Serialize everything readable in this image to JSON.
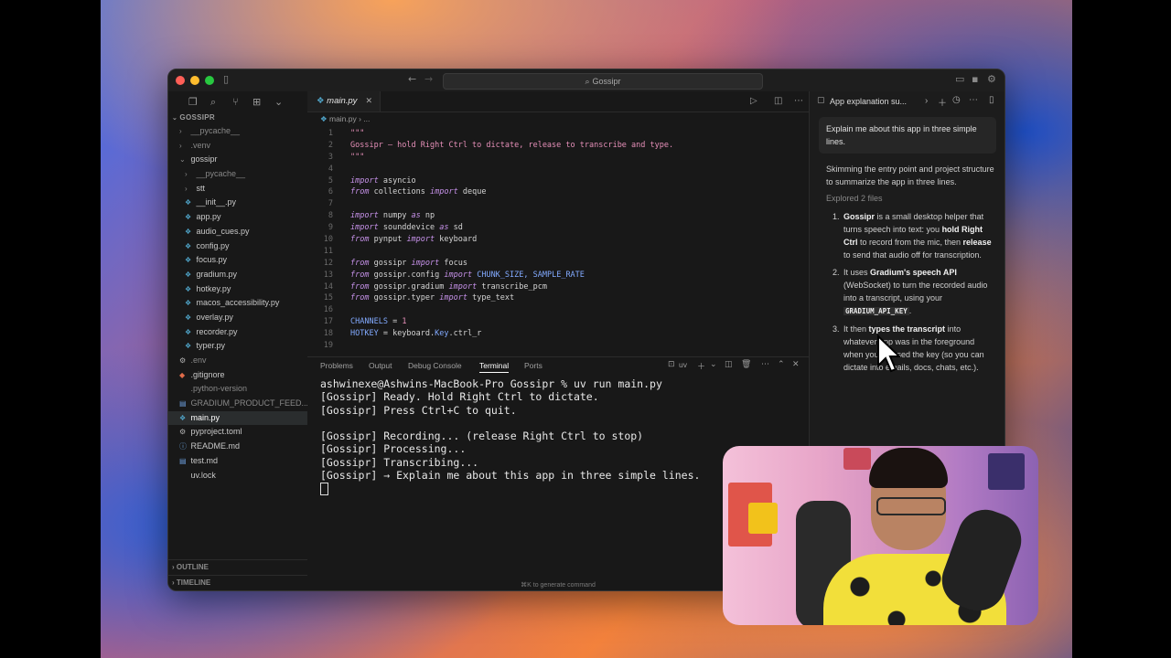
{
  "window": {
    "search_label": "Gossipr"
  },
  "sidebar": {
    "header": "GOSSIPR",
    "items": [
      {
        "label": "__pycache__",
        "type": "folder",
        "depth": 1,
        "dim": true
      },
      {
        "label": ".venv",
        "type": "folder",
        "depth": 1,
        "dim": true
      },
      {
        "label": "gossipr",
        "type": "folder-open",
        "depth": 1,
        "dim": false
      },
      {
        "label": "__pycache__",
        "type": "folder",
        "depth": 2,
        "dim": true
      },
      {
        "label": "stt",
        "type": "folder",
        "depth": 2,
        "dim": false
      },
      {
        "label": "__init__.py",
        "type": "py",
        "depth": 2,
        "dim": false
      },
      {
        "label": "app.py",
        "type": "py",
        "depth": 2,
        "dim": false
      },
      {
        "label": "audio_cues.py",
        "type": "py",
        "depth": 2,
        "dim": false
      },
      {
        "label": "config.py",
        "type": "py",
        "depth": 2,
        "dim": false
      },
      {
        "label": "focus.py",
        "type": "py",
        "depth": 2,
        "dim": false
      },
      {
        "label": "gradium.py",
        "type": "py",
        "depth": 2,
        "dim": false
      },
      {
        "label": "hotkey.py",
        "type": "py",
        "depth": 2,
        "dim": false
      },
      {
        "label": "macos_accessibility.py",
        "type": "py",
        "depth": 2,
        "dim": false
      },
      {
        "label": "overlay.py",
        "type": "py",
        "depth": 2,
        "dim": false
      },
      {
        "label": "recorder.py",
        "type": "py",
        "depth": 2,
        "dim": false
      },
      {
        "label": "typer.py",
        "type": "py",
        "depth": 2,
        "dim": false
      },
      {
        "label": ".env",
        "type": "gear",
        "depth": 1,
        "dim": true
      },
      {
        "label": ".gitignore",
        "type": "git",
        "depth": 1,
        "dim": false
      },
      {
        "label": ".python-version",
        "type": "plain",
        "depth": 1,
        "dim": true
      },
      {
        "label": "GRADIUM_PRODUCT_FEED...",
        "type": "md",
        "depth": 1,
        "dim": true
      },
      {
        "label": "main.py",
        "type": "py",
        "depth": 1,
        "dim": false,
        "selected": true
      },
      {
        "label": "pyproject.toml",
        "type": "gear",
        "depth": 1,
        "dim": false
      },
      {
        "label": "README.md",
        "type": "info",
        "depth": 1,
        "dim": false
      },
      {
        "label": "test.md",
        "type": "md",
        "depth": 1,
        "dim": false
      },
      {
        "label": "uv.lock",
        "type": "plain",
        "depth": 1,
        "dim": false
      }
    ],
    "outline_label": "OUTLINE",
    "timeline_label": "TIMELINE"
  },
  "editor": {
    "tab_label": "main.py",
    "breadcrumb": "main.py  ›  ...",
    "lines": [
      {
        "n": "1",
        "parts": [
          {
            "t": "\"\"\"",
            "c": "str"
          }
        ]
      },
      {
        "n": "2",
        "parts": [
          {
            "t": "Gossipr — hold Right Ctrl to dictate, release to transcribe and type.",
            "c": "str"
          }
        ]
      },
      {
        "n": "3",
        "parts": [
          {
            "t": "\"\"\"",
            "c": "str"
          }
        ]
      },
      {
        "n": "4",
        "parts": []
      },
      {
        "n": "5",
        "parts": [
          {
            "t": "import",
            "c": "kw"
          },
          {
            "t": " asyncio",
            "c": "txt"
          }
        ]
      },
      {
        "n": "6",
        "parts": [
          {
            "t": "from",
            "c": "kw"
          },
          {
            "t": " collections ",
            "c": "txt"
          },
          {
            "t": "import",
            "c": "kw"
          },
          {
            "t": " deque",
            "c": "txt"
          }
        ]
      },
      {
        "n": "7",
        "parts": []
      },
      {
        "n": "8",
        "parts": [
          {
            "t": "import",
            "c": "kw"
          },
          {
            "t": " numpy ",
            "c": "txt"
          },
          {
            "t": "as",
            "c": "kw"
          },
          {
            "t": " np",
            "c": "txt"
          }
        ]
      },
      {
        "n": "9",
        "parts": [
          {
            "t": "import",
            "c": "kw"
          },
          {
            "t": " sounddevice ",
            "c": "txt"
          },
          {
            "t": "as",
            "c": "kw"
          },
          {
            "t": " sd",
            "c": "txt"
          }
        ]
      },
      {
        "n": "10",
        "parts": [
          {
            "t": "from",
            "c": "kw"
          },
          {
            "t": " pynput ",
            "c": "txt"
          },
          {
            "t": "import",
            "c": "kw"
          },
          {
            "t": " keyboard",
            "c": "txt"
          }
        ]
      },
      {
        "n": "11",
        "parts": []
      },
      {
        "n": "12",
        "parts": [
          {
            "t": "from",
            "c": "kw"
          },
          {
            "t": " gossipr ",
            "c": "txt"
          },
          {
            "t": "import",
            "c": "kw"
          },
          {
            "t": " focus",
            "c": "txt"
          }
        ]
      },
      {
        "n": "13",
        "parts": [
          {
            "t": "from",
            "c": "kw"
          },
          {
            "t": " gossipr.config ",
            "c": "txt"
          },
          {
            "t": "import",
            "c": "kw"
          },
          {
            "t": " CHUNK_SIZE, SAMPLE_RATE",
            "c": "cst"
          }
        ]
      },
      {
        "n": "14",
        "parts": [
          {
            "t": "from",
            "c": "kw"
          },
          {
            "t": " gossipr.gradium ",
            "c": "txt"
          },
          {
            "t": "import",
            "c": "kw"
          },
          {
            "t": " transcribe_pcm",
            "c": "txt"
          }
        ]
      },
      {
        "n": "15",
        "parts": [
          {
            "t": "from",
            "c": "kw"
          },
          {
            "t": " gossipr.typer ",
            "c": "txt"
          },
          {
            "t": "import",
            "c": "kw"
          },
          {
            "t": " type_text",
            "c": "txt"
          }
        ]
      },
      {
        "n": "16",
        "parts": []
      },
      {
        "n": "17",
        "parts": [
          {
            "t": "CHANNELS",
            "c": "cst"
          },
          {
            "t": " = ",
            "c": "txt"
          },
          {
            "t": "1",
            "c": "str"
          }
        ]
      },
      {
        "n": "18",
        "parts": [
          {
            "t": "HOTKEY",
            "c": "cst"
          },
          {
            "t": " = keyboard.",
            "c": "txt"
          },
          {
            "t": "Key",
            "c": "cst"
          },
          {
            "t": ".ctrl_r",
            "c": "txt"
          }
        ]
      },
      {
        "n": "19",
        "parts": []
      }
    ]
  },
  "panel": {
    "tabs": [
      "Problems",
      "Output",
      "Debug Console",
      "Terminal",
      "Ports"
    ],
    "active_tab": "Terminal",
    "shell_label": "uv",
    "terminal_lines": [
      "ashwinexe@Ashwins-MacBook-Pro Gossipr % uv run main.py",
      "[Gossipr] Ready. Hold Right Ctrl to dictate.",
      "[Gossipr] Press Ctrl+C to quit.",
      "",
      "[Gossipr] Recording... (release Right Ctrl to stop)",
      "[Gossipr] Processing...",
      "[Gossipr] Transcribing...",
      "[Gossipr] → Explain me about this app in three simple lines."
    ],
    "hint": "⌘K to generate command"
  },
  "chat": {
    "title": "App explanation su...",
    "user_message": "Explain me about this app in three simple lines.",
    "assistant_intro": "Skimming the entry point and project structure to summarize the app in three lines.",
    "explored_label": "Explored",
    "explored_count": "2 files",
    "points": [
      {
        "n": "1.",
        "segments": [
          {
            "b": "Gossipr"
          },
          {
            "t": " is a small desktop helper that turns speech into text: you "
          },
          {
            "b": "hold Right Ctrl"
          },
          {
            "t": " to record from the mic, then "
          },
          {
            "b": "release"
          },
          {
            "t": " to send that audio off for transcription."
          }
        ]
      },
      {
        "n": "2.",
        "segments": [
          {
            "t": "It uses "
          },
          {
            "b": "Gradium's speech API"
          },
          {
            "t": " (WebSocket) to turn the recorded audio into a transcript, using your "
          },
          {
            "code": "GRADIUM_API_KEY"
          },
          {
            "t": "."
          }
        ]
      },
      {
        "n": "3.",
        "segments": [
          {
            "t": "It then "
          },
          {
            "b": "types the transcript"
          },
          {
            "t": " into whatever app was in the foreground when you pressed the key (so you can dictate into emails, docs, chats, etc.)."
          }
        ]
      }
    ],
    "more": "..."
  }
}
